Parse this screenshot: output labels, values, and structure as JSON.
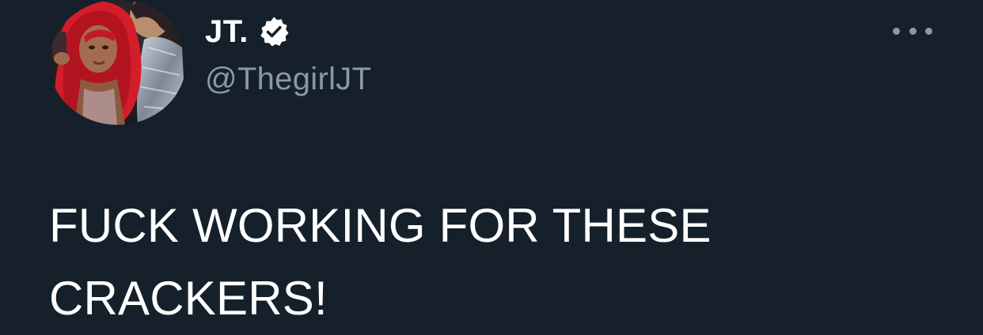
{
  "tweet": {
    "author": {
      "display_name": "JT.",
      "handle": "@ThegirlJT",
      "verified_icon": "verified-badge-icon",
      "avatar": "profile-photo"
    },
    "more_icon": "more-options-icon",
    "text": "FUCK WORKING FOR THESE\nCRACKERS!"
  },
  "colors": {
    "background": "#16202b",
    "primary_text": "#ffffff",
    "secondary_text": "#8b98a5"
  }
}
